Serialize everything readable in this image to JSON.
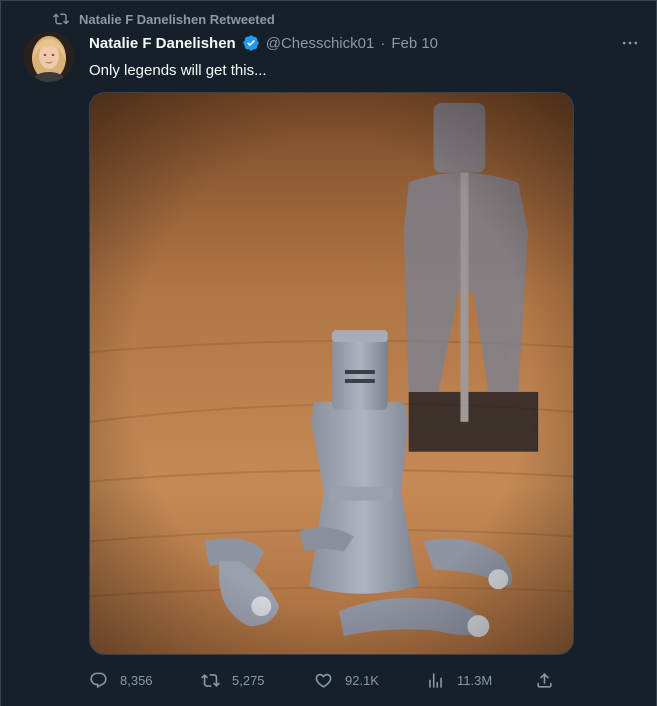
{
  "retweet_banner": {
    "text": "Natalie F Danelishen Retweeted",
    "icon": "retweet-icon"
  },
  "author": {
    "name": "Natalie F Danelishen",
    "handle": "@Chesschick01",
    "separator": "·",
    "date": "Feb 10",
    "verified": true
  },
  "tweet": {
    "text": "Only legends will get this..."
  },
  "actions": {
    "replies": {
      "icon": "reply-icon",
      "count": "8,356"
    },
    "retweets": {
      "icon": "retweet-icon",
      "count": "5,275"
    },
    "likes": {
      "icon": "heart-icon",
      "count": "92.1K"
    },
    "views": {
      "icon": "views-icon",
      "count": "11.3M"
    },
    "share": {
      "icon": "share-icon"
    }
  },
  "colors": {
    "background": "#15202b",
    "secondary_text": "#8b98a5",
    "verified_blue": "#1d9bf0",
    "primary_text": "#f7f9f9"
  }
}
